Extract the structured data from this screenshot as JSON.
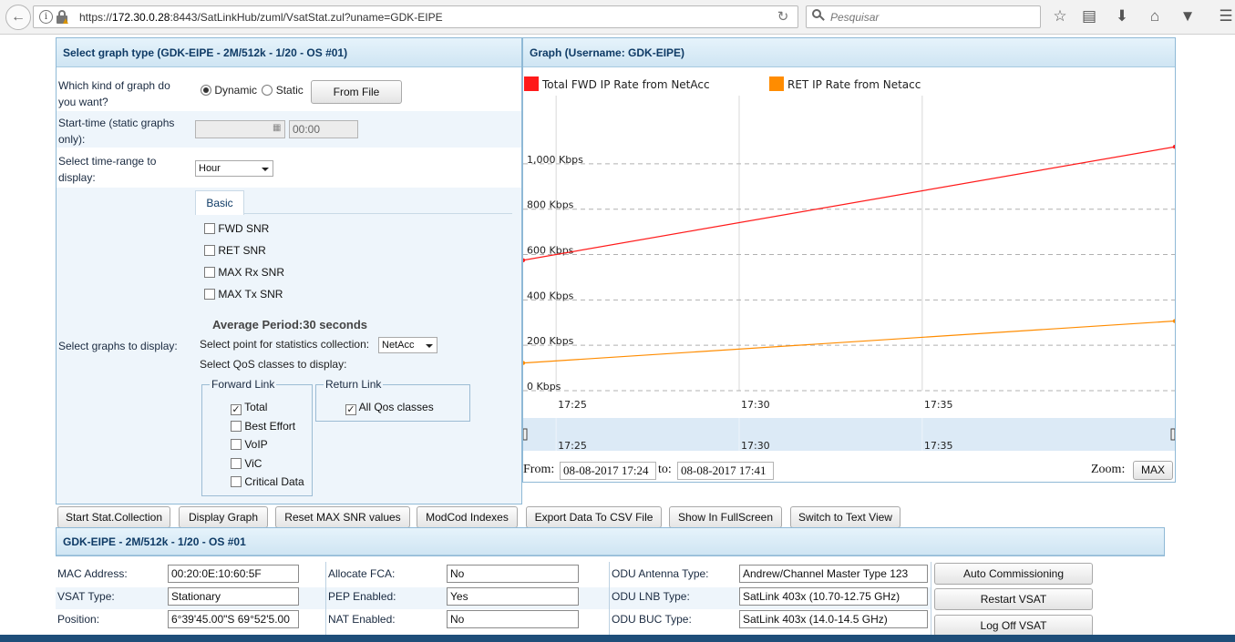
{
  "browser": {
    "url_prefix": "https://",
    "url_host": "172.30.0.28",
    "url_rest": ":8443/SatLinkHub/zuml/VsatStat.zul?uname=GDK-EIPE",
    "search_placeholder": "Pesquisar"
  },
  "left_panel": {
    "title": "Select graph type (GDK-EIPE - 2M/512k - 1/20 - OS #01)",
    "graph_kind_label": "Which kind of graph do you want?",
    "dynamic_label": "Dynamic",
    "static_label": "Static",
    "from_file_button": "From File",
    "start_time_label": "Start-time (static graphs only):",
    "start_time_value": "00:00",
    "time_range_label": "Select time-range to display:",
    "time_range_value": "Hour",
    "tab_basic": "Basic",
    "graphs_label": "Select graphs to display:",
    "checkboxes": [
      "FWD SNR",
      "RET SNR",
      "MAX Rx SNR",
      "MAX Tx SNR"
    ],
    "average_period": "Average Period:30 seconds",
    "stat_point_label": "Select point for statistics collection:",
    "stat_point_value": "NetAcc",
    "qos_label": "Select QoS classes to display:",
    "forward_link_legend": "Forward Link",
    "forward_items": [
      {
        "label": "Total",
        "checked": true
      },
      {
        "label": "Best Effort",
        "checked": false
      },
      {
        "label": "VoIP",
        "checked": false
      },
      {
        "label": "ViC",
        "checked": false
      },
      {
        "label": "Critical Data",
        "checked": false
      }
    ],
    "return_link_legend": "Return Link",
    "return_items": [
      {
        "label": "All Qos classes",
        "checked": true
      }
    ]
  },
  "right_panel": {
    "title": "Graph (Username: GDK-EIPE)",
    "from_label": "From:",
    "from_value": "08-08-2017 17:24",
    "to_label": "to:",
    "to_value": "08-08-2017 17:41",
    "zoom_label": "Zoom:",
    "zoom_button": "MAX"
  },
  "chart_data": {
    "type": "line",
    "x_tick_labels": [
      "17:25",
      "17:30",
      "17:35"
    ],
    "x_ticks": [
      0,
      5,
      10
    ],
    "x_range": [
      -0.9,
      16.9
    ],
    "navigator_tick_labels": [
      "17:25",
      "17:30",
      "17:35"
    ],
    "y_ticks": [
      0,
      200,
      400,
      600,
      800,
      1000
    ],
    "y_tick_labels": [
      "0 Kbps",
      "200 Kbps",
      "400 Kbps",
      "600 Kbps",
      "800 Kbps",
      "1,000 Kbps"
    ],
    "ylim": [
      0,
      1120
    ],
    "grid": true,
    "legend_position": "top",
    "series": [
      {
        "name": "Total FWD IP Rate from NetAcc",
        "color": "#ff1a1a",
        "x": [
          -0.9,
          16.9
        ],
        "y": [
          575,
          1075
        ]
      },
      {
        "name": "RET IP Rate from Netacc",
        "color": "#ff8c00",
        "x": [
          -0.9,
          16.9
        ],
        "y": [
          122,
          307
        ]
      }
    ]
  },
  "actions": [
    "Start Stat.Collection",
    "Display Graph",
    "Reset MAX SNR values",
    "ModCod Indexes",
    "Export Data To CSV File",
    "Show In FullScreen",
    "Switch to Text View"
  ],
  "info": {
    "title": "GDK-EIPE - 2M/512k - 1/20 - OS #01",
    "col1": [
      {
        "label": "MAC Address:",
        "value": "00:20:0E:10:60:5F"
      },
      {
        "label": "VSAT Type:",
        "value": "Stationary"
      },
      {
        "label": "Position:",
        "value": "6°39'45.00\"S 69°52'5.00"
      }
    ],
    "col2": [
      {
        "label": "Allocate FCA:",
        "value": "No"
      },
      {
        "label": "PEP Enabled:",
        "value": "Yes"
      },
      {
        "label": "NAT Enabled:",
        "value": "No"
      }
    ],
    "col3": [
      {
        "label": "ODU Antenna Type:",
        "value": "Andrew/Channel Master Type 123"
      },
      {
        "label": "ODU LNB Type:",
        "value": "SatLink 403x (10.70-12.75 GHz)"
      },
      {
        "label": "ODU BUC Type:",
        "value": "SatLink 403x (14.0-14.5 GHz)"
      }
    ],
    "buttons": [
      "Auto Commissioning",
      "Restart VSAT",
      "Log Off VSAT"
    ]
  }
}
